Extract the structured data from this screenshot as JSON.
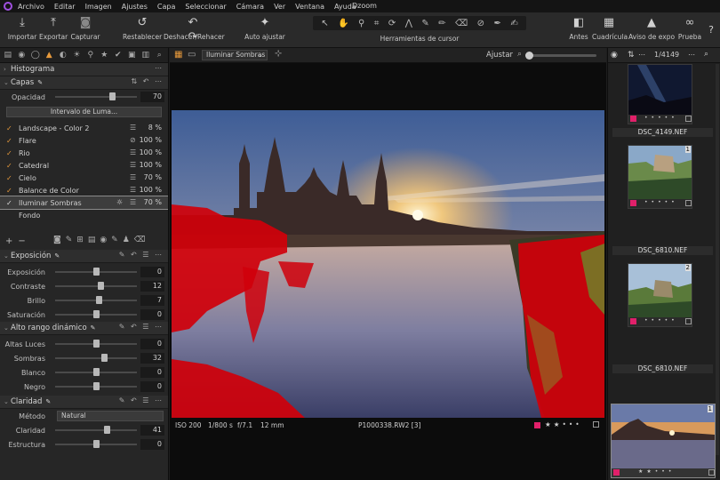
{
  "menu": {
    "items": [
      "Archivo",
      "Editar",
      "Imagen",
      "Ajustes",
      "Capa",
      "Seleccionar",
      "Cámara",
      "Ver",
      "Ventana",
      "Ayuda"
    ],
    "app_name": "Dzoom"
  },
  "toolbar": {
    "importar": "Importar",
    "exportar": "Exportar",
    "capturar": "Capturar",
    "restablecer": "Restablecer",
    "deshacer": "Deshacer/Rehacer",
    "auto": "Auto ajustar",
    "cursor_tools": "Herramientas de cursor",
    "antes": "Antes",
    "cuadricula": "Cuadrícula",
    "aviso": "Aviso de expo",
    "prueba": "Prueba"
  },
  "histograma": {
    "title": "Histograma"
  },
  "capas": {
    "title": "Capas",
    "opacidad_label": "Opacidad",
    "opacidad_value": "70",
    "opacidad_level": 0.7,
    "luma_button": "Intervalo de Luma...",
    "layers": [
      {
        "name": "Landscape - Color 2",
        "pct": "8 %"
      },
      {
        "name": "Flare",
        "pct": "100 %"
      },
      {
        "name": "Rio",
        "pct": "100 %"
      },
      {
        "name": "Catedral",
        "pct": "100 %"
      },
      {
        "name": "Cielo",
        "pct": "70 %"
      },
      {
        "name": "Balance de Color",
        "pct": "100 %"
      },
      {
        "name": "Iluminar Sombras",
        "pct": "70 %"
      }
    ],
    "fondo": "Fondo"
  },
  "exposicion": {
    "title": "Exposición",
    "rows": [
      {
        "label": "Exposición",
        "value": "0",
        "level": 0.5
      },
      {
        "label": "Contraste",
        "value": "12",
        "level": 0.56
      },
      {
        "label": "Brillo",
        "value": "7",
        "level": 0.54
      },
      {
        "label": "Saturación",
        "value": "0",
        "level": 0.5
      }
    ]
  },
  "hdr": {
    "title": "Alto rango dinámico",
    "rows": [
      {
        "label": "Altas Luces",
        "value": "0",
        "level": 0.5
      },
      {
        "label": "Sombras",
        "value": "32",
        "level": 0.6
      },
      {
        "label": "Blanco",
        "value": "0",
        "level": 0.5
      },
      {
        "label": "Negro",
        "value": "0",
        "level": 0.5
      }
    ]
  },
  "claridad": {
    "title": "Claridad",
    "metodo_label": "Método",
    "metodo_value": "Natural",
    "rows": [
      {
        "label": "Claridad",
        "value": "41",
        "level": 0.64
      },
      {
        "label": "Estructura",
        "value": "0",
        "level": 0.5
      }
    ]
  },
  "viewer": {
    "layer_select": "Iluminar Sombras",
    "ajustar": "Ajustar",
    "iso": "ISO 200",
    "shutter": "1/800 s",
    "aperture": "f/7.1",
    "focal": "12 mm",
    "filename": "P1000338.RW2 [3]",
    "rating": 2
  },
  "browser": {
    "count": "1/4149",
    "thumbs": [
      {
        "name": "DSC_4149.NEF",
        "rating": 0,
        "badge": ""
      },
      {
        "name": "DSC_6810.NEF",
        "rating": 0,
        "badge": "1"
      },
      {
        "name": "DSC_6810.NEF",
        "rating": 0,
        "badge": "2"
      },
      {
        "name": "",
        "rating": 2,
        "badge": "1"
      }
    ]
  },
  "colors": {
    "accent": "#e89a3c",
    "label": "#e0206a",
    "mask": "#d0000a"
  }
}
